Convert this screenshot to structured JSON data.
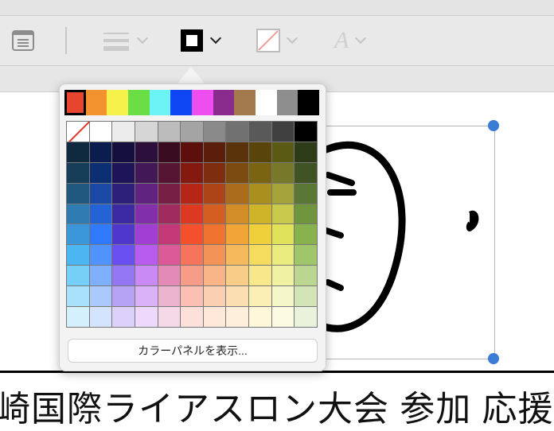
{
  "toolbar": {
    "items": [
      {
        "name": "text-box-icon"
      },
      {
        "name": "shape-style-icon"
      },
      {
        "name": "border-color-icon"
      },
      {
        "name": "fill-color-icon"
      },
      {
        "name": "text-style-icon",
        "glyph": "A"
      }
    ]
  },
  "canvas": {
    "background_text": "崎国際ライアスロン大会 参加 応援"
  },
  "color_popover": {
    "recent_colors": [
      "#e8452f",
      "#f39330",
      "#f7f14c",
      "#6bde46",
      "#6cf3f6",
      "#1047f5",
      "#ee4ef0",
      "#8a2c8e",
      "#a27a4d",
      "#ffffff",
      "#8e8e8e",
      "#000000"
    ],
    "current_color": "#e8452f",
    "grid": [
      [
        "none",
        "#ffffff",
        "#ececec",
        "#d6d6d6",
        "#bcbcbc",
        "#a4a4a4",
        "#8a8a8a",
        "#717171",
        "#595959",
        "#404040",
        "#000000"
      ],
      [
        "#0f2a3f",
        "#0b1d4f",
        "#140f3f",
        "#2c0f3b",
        "#3a0c21",
        "#5d0f0c",
        "#5a1e0b",
        "#5a330a",
        "#594409",
        "#5b5a14",
        "#2e3b18"
      ],
      [
        "#163e58",
        "#0c2f74",
        "#1d1558",
        "#431857",
        "#561532",
        "#84190f",
        "#7e2e0f",
        "#7b4b10",
        "#7a6311",
        "#78782a",
        "#3f5324"
      ],
      [
        "#21587f",
        "#1a48a4",
        "#2c207a",
        "#612380",
        "#781f46",
        "#b52616",
        "#ad4418",
        "#ab6d1b",
        "#a88f1e",
        "#a5a43b",
        "#5a7735"
      ],
      [
        "#2e7cb1",
        "#2463d6",
        "#3c2aa3",
        "#8230aa",
        "#a02b5f",
        "#dd3922",
        "#d45d22",
        "#d28d27",
        "#cfb42a",
        "#c9c94c",
        "#6f953f"
      ],
      [
        "#3b97d9",
        "#2f7afc",
        "#4f36cd",
        "#a13ed3",
        "#c43878",
        "#f4502c",
        "#f07330",
        "#f0a536",
        "#f0d03a",
        "#e0e35a",
        "#87b24e"
      ],
      [
        "#4cb6f2",
        "#5093fc",
        "#6a4ff0",
        "#b85cef",
        "#dd5a99",
        "#f5745b",
        "#f49358",
        "#f4ba5c",
        "#f5dc5f",
        "#eaeb7e",
        "#9fc66b"
      ],
      [
        "#75cff6",
        "#7eb0fd",
        "#9376f3",
        "#c98af3",
        "#e48ab6",
        "#f89c8a",
        "#f8b386",
        "#f8cd88",
        "#f9e78b",
        "#f0f1a3",
        "#bad690"
      ],
      [
        "#a8e1f9",
        "#aac9fd",
        "#b6a3f6",
        "#dab2f7",
        "#edb4cf",
        "#fbc0b3",
        "#fbcfb2",
        "#fbdfb3",
        "#fcefb5",
        "#f6f7c8",
        "#d3e5b7"
      ],
      [
        "#d3f0fc",
        "#d5e4fe",
        "#dbd1fb",
        "#edd9fb",
        "#f6d9e7",
        "#fde0d9",
        "#fde8d9",
        "#fdefd9",
        "#fef7da",
        "#fbfbe3",
        "#e9f2db"
      ]
    ],
    "panel_button_label": "カラーパネルを表示..."
  }
}
